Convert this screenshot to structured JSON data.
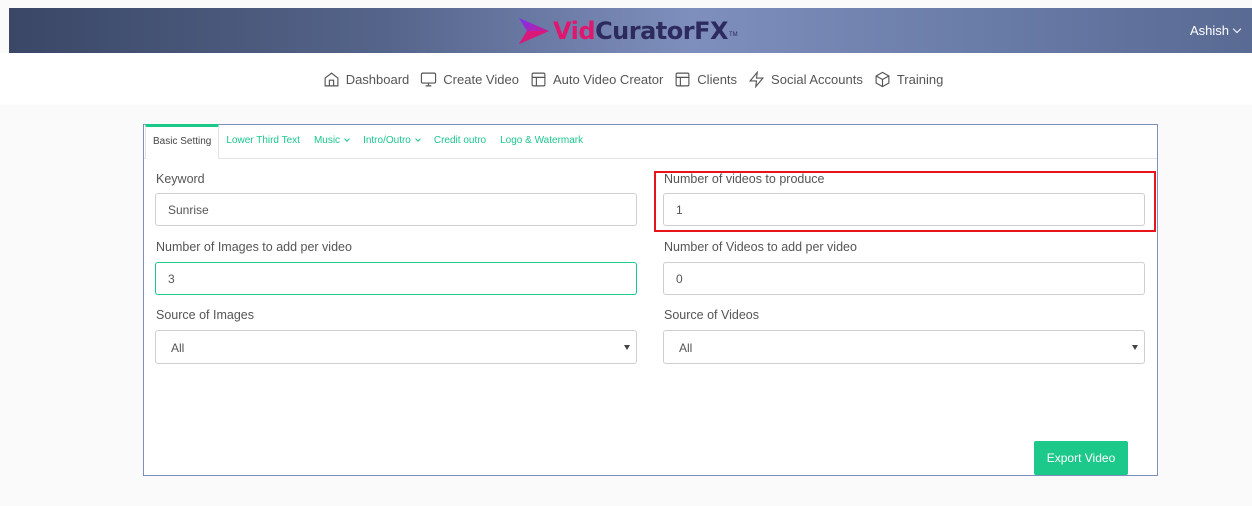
{
  "header": {
    "logo_vid": "Vid",
    "logo_rest": "CuratorFX",
    "logo_tm": "TM",
    "user_name": "Ashish"
  },
  "nav": {
    "items": [
      {
        "label": "Dashboard",
        "icon": "home-icon"
      },
      {
        "label": "Create Video",
        "icon": "monitor-icon"
      },
      {
        "label": "Auto Video Creator",
        "icon": "layout-icon"
      },
      {
        "label": "Clients",
        "icon": "layout-icon"
      },
      {
        "label": "Social Accounts",
        "icon": "zap-icon"
      },
      {
        "label": "Training",
        "icon": "box-icon"
      }
    ]
  },
  "tabs": [
    {
      "label": "Basic Setting",
      "active": true
    },
    {
      "label": "Lower Third Text"
    },
    {
      "label": "Music",
      "dropdown": true
    },
    {
      "label": "Intro/Outro",
      "dropdown": true
    },
    {
      "label": "Credit outro"
    },
    {
      "label": "Logo & Watermark"
    }
  ],
  "form": {
    "keyword_label": "Keyword",
    "keyword_value": "Sunrise",
    "num_videos_produce_label": "Number of videos to produce",
    "num_videos_produce_value": "1",
    "num_images_label": "Number of Images to add per video",
    "num_images_value": "3",
    "num_videos_add_label": "Number of Videos to add per video",
    "num_videos_add_value": "0",
    "source_images_label": "Source of Images",
    "source_images_value": "All",
    "source_videos_label": "Source of Videos",
    "source_videos_value": "All"
  },
  "export_button": "Export Video",
  "colors": {
    "accent": "#1cc88a",
    "highlight": "#e8141c",
    "logo_pink": "#e0176f",
    "logo_navy": "#2d2a5e"
  }
}
